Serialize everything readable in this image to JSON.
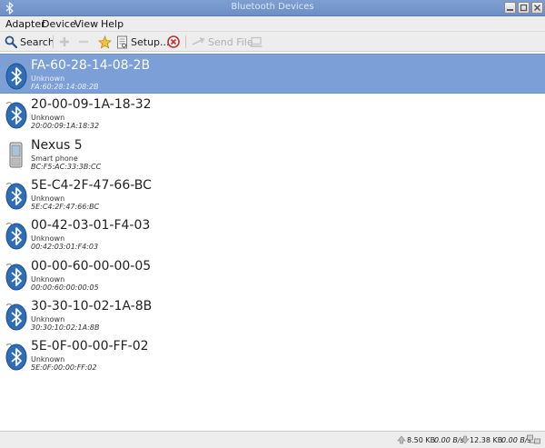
{
  "window": {
    "title": "Bluetooth Devices",
    "app_icon": "bluetooth-icon"
  },
  "menu": {
    "adapter": "Adapter",
    "device": "Device",
    "view": "View",
    "help": "Help"
  },
  "toolbar": {
    "search_label": "Search",
    "setup_label": "Setup...",
    "send_file_label": "Send File"
  },
  "devices": [
    {
      "name": "FA-60-28-14-08-2B",
      "type": "Unknown",
      "address": "FA:60:28:14:08:2B",
      "icon": "bluetooth-icon",
      "selected": true
    },
    {
      "name": "20-00-09-1A-18-32",
      "type": "Unknown",
      "address": "20:00:09:1A:18:32",
      "icon": "bluetooth-icon"
    },
    {
      "name": "Nexus 5",
      "type": "Smart phone",
      "address": "BC:F5:AC:33:3B:CC",
      "icon": "smartphone-icon"
    },
    {
      "name": "5E-C4-2F-47-66-BC",
      "type": "Unknown",
      "address": "5E:C4:2F:47:66:BC",
      "icon": "bluetooth-icon"
    },
    {
      "name": "00-42-03-01-F4-03",
      "type": "Unknown",
      "address": "00:42:03:01:F4:03",
      "icon": "bluetooth-icon"
    },
    {
      "name": "00-00-60-00-00-05",
      "type": "Unknown",
      "address": "00:00:60:00:00:05",
      "icon": "bluetooth-icon"
    },
    {
      "name": "30-30-10-02-1A-8B",
      "type": "Unknown",
      "address": "30:30:10:02:1A:8B",
      "icon": "bluetooth-icon"
    },
    {
      "name": "5E-0F-00-00-FF-02",
      "type": "Unknown",
      "address": "5E:0F:00:00:FF:02",
      "icon": "bluetooth-icon"
    }
  ],
  "status": {
    "upload_total": "8.50 KB",
    "upload_rate": "0.00 B/s",
    "download_total": "12.38 KB",
    "download_rate": "0.00 B/s"
  },
  "colors": {
    "selection": "#7b9fd6",
    "titlebar": "#7e9fd0",
    "bluetooth_blue": "#2f6db6"
  }
}
